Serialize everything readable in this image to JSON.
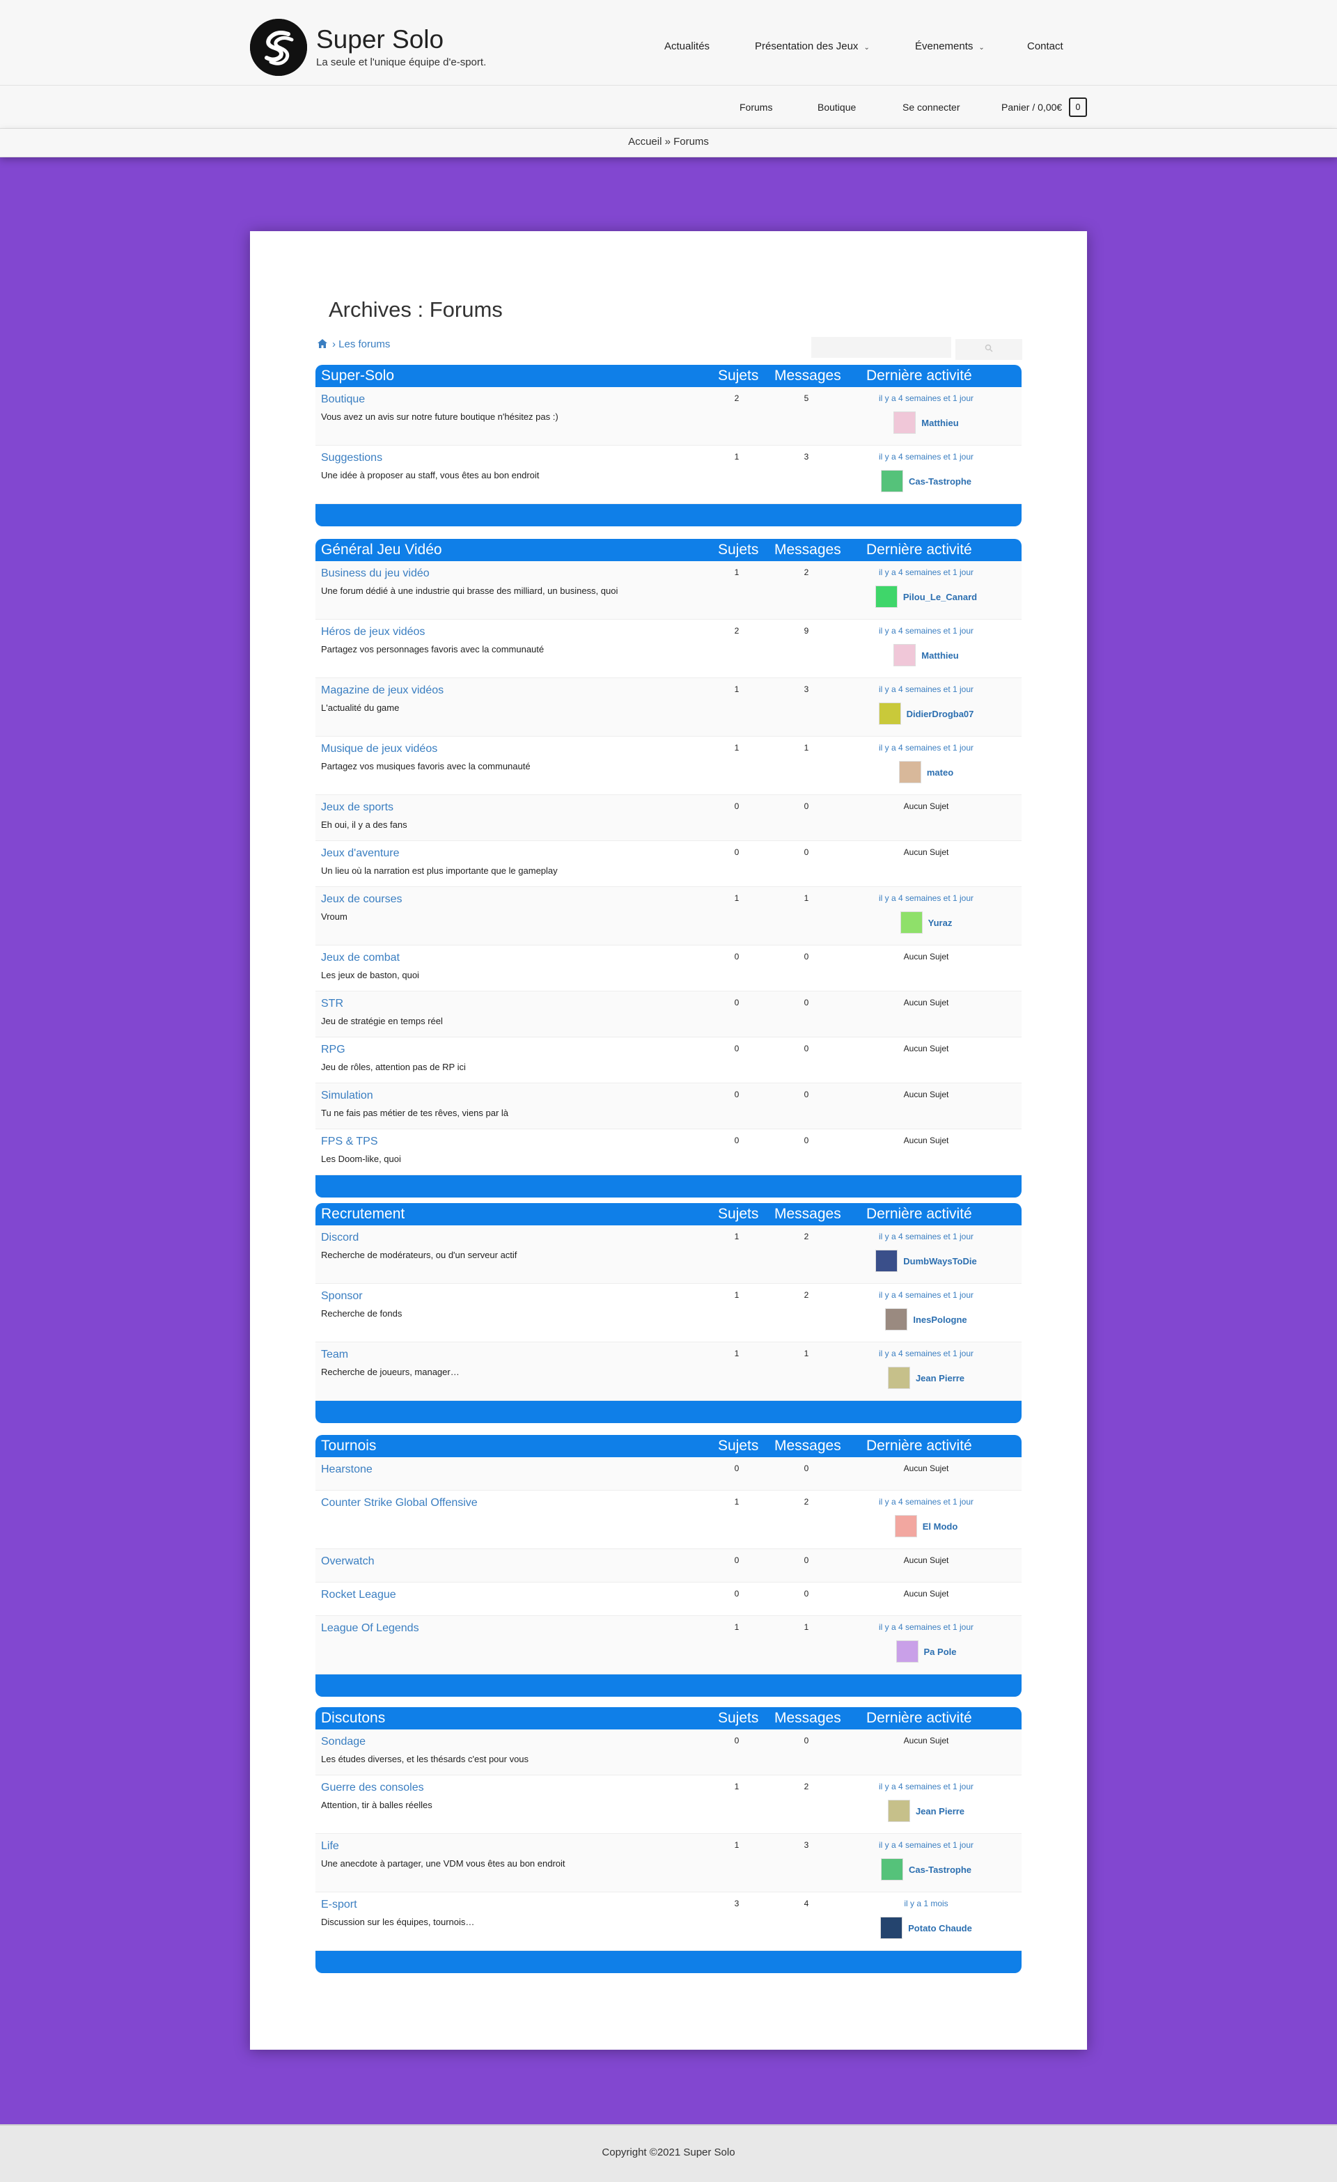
{
  "site": {
    "title": "Super Solo",
    "tagline": "La seule et l'unique équipe d'e-sport."
  },
  "nav": [
    {
      "label": "Actualités",
      "dropdown": false
    },
    {
      "label": "Présentation des Jeux",
      "dropdown": true
    },
    {
      "label": "Évenements",
      "dropdown": true
    },
    {
      "label": "Contact",
      "dropdown": false
    }
  ],
  "secnav": {
    "forums": "Forums",
    "boutique": "Boutique",
    "login": "Se connecter",
    "cart": "Panier / 0,00€",
    "cart_count": "0"
  },
  "breadcrumb": "Accueil » Forums",
  "page": {
    "title": "Archives : Forums",
    "crumb": "› Les forums"
  },
  "columns": {
    "topics": "Sujets",
    "posts": "Messages",
    "activity": "Dernière activité"
  },
  "colors": {
    "accent": "#0f7fe8",
    "background": "#8247d0",
    "link": "#3a7ec1"
  },
  "categories": [
    {
      "name": "Super-Solo",
      "forums": [
        {
          "name": "Boutique",
          "desc": "Vous avez un avis sur notre future boutique n'hésitez pas :)",
          "topics": "2",
          "posts": "5",
          "activity": "il y a 4 semaines et 1 jour",
          "user": "Matthieu",
          "avatar": "#f0c7d8"
        },
        {
          "name": "Suggestions",
          "desc": "Une idée à proposer au staff, vous êtes au bon endroit",
          "topics": "1",
          "posts": "3",
          "activity": "il y a 4 semaines et 1 jour",
          "user": "Cas-Tastrophe",
          "avatar": "#55c27a"
        }
      ]
    },
    {
      "name": "Général Jeu Vidéo",
      "forums": [
        {
          "name": "Business du jeu vidéo",
          "desc": "Une forum dédié à une industrie qui brasse des milliard, un business, quoi",
          "topics": "1",
          "posts": "2",
          "activity": "il y a 4 semaines et 1 jour",
          "user": "Pilou_Le_Canard",
          "avatar": "#3fd66a"
        },
        {
          "name": "Héros de jeux vidéos",
          "desc": "Partagez vos personnages favoris avec la communauté",
          "topics": "2",
          "posts": "9",
          "activity": "il y a 4 semaines et 1 jour",
          "user": "Matthieu",
          "avatar": "#f0c7d8"
        },
        {
          "name": "Magazine de jeux vidéos",
          "desc": "L'actualité du game",
          "topics": "1",
          "posts": "3",
          "activity": "il y a 4 semaines et 1 jour",
          "user": "DidierDrogba07",
          "avatar": "#c9c93a"
        },
        {
          "name": "Musique de jeux vidéos",
          "desc": "Partagez vos musiques favoris avec la communauté",
          "topics": "1",
          "posts": "1",
          "activity": "il y a 4 semaines et 1 jour",
          "user": "mateo",
          "avatar": "#d8b89a"
        },
        {
          "name": "Jeux de sports",
          "desc": "Eh oui, il y a des fans",
          "topics": "0",
          "posts": "0",
          "activity": "Aucun Sujet"
        },
        {
          "name": "Jeux d'aventure",
          "desc": "Un lieu où la narration est plus importante que le gameplay",
          "topics": "0",
          "posts": "0",
          "activity": "Aucun Sujet"
        },
        {
          "name": "Jeux de courses",
          "desc": "Vroum",
          "topics": "1",
          "posts": "1",
          "activity": "il y a 4 semaines et 1 jour",
          "user": "Yuraz",
          "avatar": "#8fe06a"
        },
        {
          "name": "Jeux de combat",
          "desc": "Les jeux de baston, quoi",
          "topics": "0",
          "posts": "0",
          "activity": "Aucun Sujet"
        },
        {
          "name": "STR",
          "desc": "Jeu de stratégie en temps réel",
          "topics": "0",
          "posts": "0",
          "activity": "Aucun Sujet"
        },
        {
          "name": "RPG",
          "desc": "Jeu de rôles, attention pas de RP ici",
          "topics": "0",
          "posts": "0",
          "activity": "Aucun Sujet"
        },
        {
          "name": "Simulation",
          "desc": "Tu ne fais pas métier de tes rêves, viens par là",
          "topics": "0",
          "posts": "0",
          "activity": "Aucun Sujet"
        },
        {
          "name": "FPS & TPS",
          "desc": "Les Doom-like, quoi",
          "topics": "0",
          "posts": "0",
          "activity": "Aucun Sujet"
        }
      ]
    },
    {
      "name": "Recrutement",
      "forums": [
        {
          "name": "Discord",
          "desc": "Recherche de modérateurs, ou d'un serveur actif",
          "topics": "1",
          "posts": "2",
          "activity": "il y a 4 semaines et 1 jour",
          "user": "DumbWaysToDie",
          "avatar": "#3a4f8a"
        },
        {
          "name": "Sponsor",
          "desc": "Recherche de fonds",
          "topics": "1",
          "posts": "2",
          "activity": "il y a 4 semaines et 1 jour",
          "user": "InesPologne",
          "avatar": "#9a8a80"
        },
        {
          "name": "Team",
          "desc": "Recherche de joueurs, manager…",
          "topics": "1",
          "posts": "1",
          "activity": "il y a 4 semaines et 1 jour",
          "user": "Jean Pierre",
          "avatar": "#c6c08a"
        }
      ]
    },
    {
      "name": "Tournois",
      "forums": [
        {
          "name": "Hearstone",
          "desc": "",
          "topics": "0",
          "posts": "0",
          "activity": "Aucun Sujet"
        },
        {
          "name": "Counter Strike Global Offensive",
          "desc": "",
          "topics": "1",
          "posts": "2",
          "activity": "il y a 4 semaines et 1 jour",
          "user": "El Modo",
          "avatar": "#f2a7a0"
        },
        {
          "name": "Overwatch",
          "desc": "",
          "topics": "0",
          "posts": "0",
          "activity": "Aucun Sujet"
        },
        {
          "name": "Rocket League",
          "desc": "",
          "topics": "0",
          "posts": "0",
          "activity": "Aucun Sujet"
        },
        {
          "name": "League Of Legends",
          "desc": "",
          "topics": "1",
          "posts": "1",
          "activity": "il y a 4 semaines et 1 jour",
          "user": "Pa Pole",
          "avatar": "#c9a0e8"
        }
      ]
    },
    {
      "name": "Discutons",
      "forums": [
        {
          "name": "Sondage",
          "desc": "Les études diverses, et les thésards c'est pour vous",
          "topics": "0",
          "posts": "0",
          "activity": "Aucun Sujet"
        },
        {
          "name": "Guerre des consoles",
          "desc": "Attention, tir à balles réelles",
          "topics": "1",
          "posts": "2",
          "activity": "il y a 4 semaines et 1 jour",
          "user": "Jean Pierre",
          "avatar": "#c6c08a"
        },
        {
          "name": "Life",
          "desc": "Une anecdote à partager, une VDM vous êtes au bon endroit",
          "topics": "1",
          "posts": "3",
          "activity": "il y a 4 semaines et 1 jour",
          "user": "Cas-Tastrophe",
          "avatar": "#55c27a"
        },
        {
          "name": "E-sport",
          "desc": "Discussion sur les équipes, tournois…",
          "topics": "3",
          "posts": "4",
          "activity": "il y a 1 mois",
          "user": "Potato Chaude",
          "avatar": "#24446e"
        }
      ]
    }
  ],
  "footer": "Copyright ©2021 Super Solo"
}
